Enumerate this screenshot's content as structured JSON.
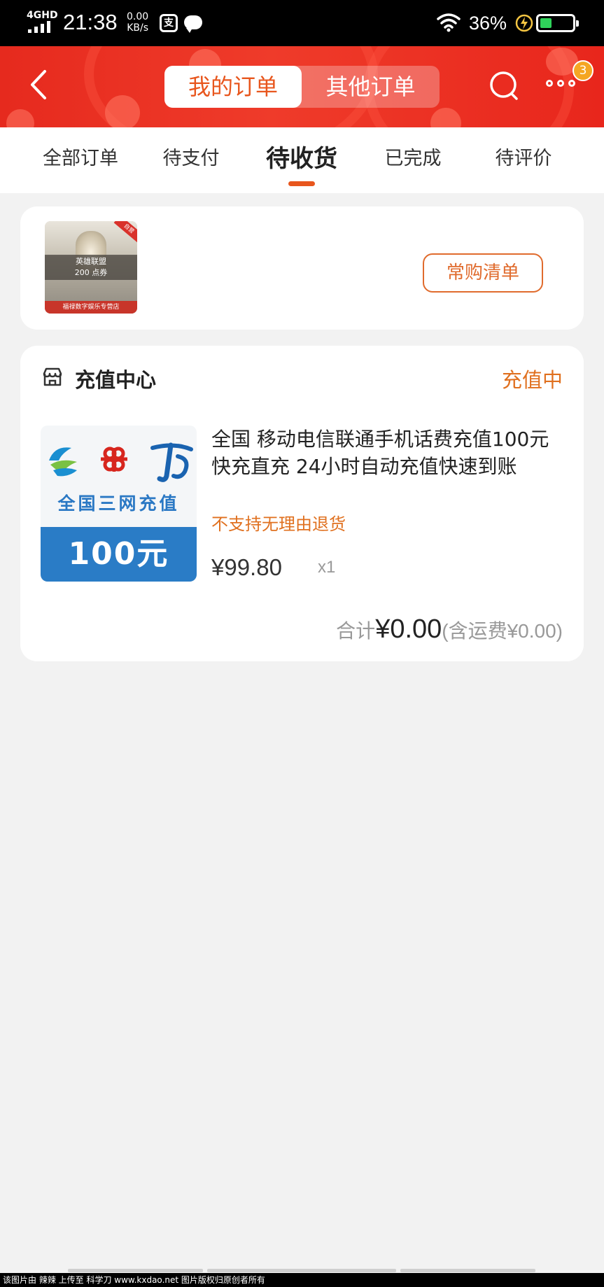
{
  "status_bar": {
    "network": "4GHD",
    "time": "21:38",
    "speed_value": "0.00",
    "speed_unit": "KB/s",
    "battery_percent": "36%",
    "battery_level": 0.36,
    "battery_color": "#2fd35a",
    "icons": [
      "signal-icon",
      "alipay-icon",
      "chat-icon",
      "wifi-icon",
      "charging-icon",
      "battery-icon"
    ]
  },
  "header": {
    "tabs": [
      {
        "label": "我的订单",
        "active": true
      },
      {
        "label": "其他订单",
        "active": false
      }
    ],
    "more_badge": "3",
    "accent_color": "#e8561d",
    "background_color": "#e62a1e"
  },
  "order_tabs": [
    {
      "label": "全部订单",
      "active": false
    },
    {
      "label": "待支付",
      "active": false
    },
    {
      "label": "待收货",
      "active": true
    },
    {
      "label": "已完成",
      "active": false
    },
    {
      "label": "待评价",
      "active": false
    }
  ],
  "frequent_card": {
    "thumb_tag": "自营",
    "thumb_line1": "英雄联盟",
    "thumb_line2": "200 点券",
    "thumb_store": "福禄数字娱乐专营店",
    "button_label": "常购清单"
  },
  "order": {
    "shop_name": "充值中心",
    "status": "充值中",
    "product_image_text": "全国三网充值",
    "product_image_amount": "100元",
    "title": "全国 移动电信联通手机话费充值100元 快充直充 24小时自动充值快速到账",
    "note": "不支持无理由退货",
    "price": "¥99.80",
    "quantity": "x1",
    "total_label": "合计",
    "total_amount": "¥0.00",
    "shipping": "(含运费¥0.00)"
  },
  "watermark": "该图片由 辣辣 上传至 科学刀 www.kxdao.net 图片版权归原创者所有"
}
